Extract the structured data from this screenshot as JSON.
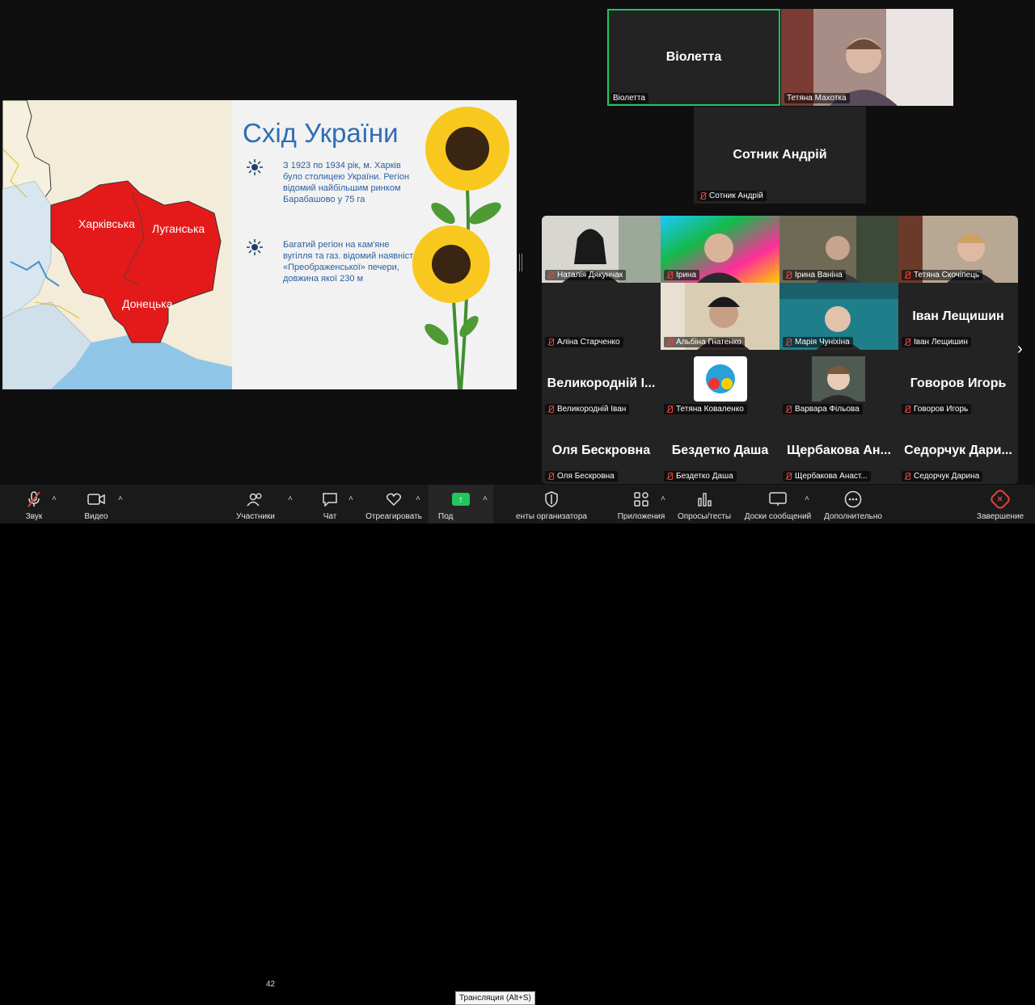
{
  "slide": {
    "title": "Схід України",
    "bullets": [
      "З 1923 по 1934 рік, м. Харків було столицею України. Регіон відомий найбільшим ринком Барабашово у 75 га",
      "Багатий регіон на кам'яне вугілля та газ. відомий наявністю «Преображенської» печери, довжина якої 230 м"
    ],
    "regions": [
      "Харківська",
      "Луганська",
      "Донецька"
    ]
  },
  "top_tiles": [
    {
      "big": "Віолетта",
      "caption": "Віолетта"
    },
    {
      "caption": "Тетяна Махотка"
    },
    {
      "big": "Сотник Андрій",
      "caption": "Сотник Андрій"
    }
  ],
  "gallery": [
    {
      "caption": "Наталія Дякунчак"
    },
    {
      "caption": "Ірина"
    },
    {
      "caption": "Ірина Ваніна"
    },
    {
      "caption": "Тетяна Скочіпець"
    },
    {
      "caption": "Аліна Старченко"
    },
    {
      "caption": "Альбіна Гнатенко"
    },
    {
      "caption": "Марія Чуніхіна"
    },
    {
      "big": "Іван Лещишин",
      "caption": "Іван Лещишин"
    },
    {
      "big": "Великородній І...",
      "caption": "Великородній Іван"
    },
    {
      "caption": "Тетяна Коваленко"
    },
    {
      "caption": "Варвара Фільова"
    },
    {
      "big": "Говоров Игорь",
      "caption": "Говоров Игорь"
    },
    {
      "big": "Оля Бескровна",
      "caption": "Оля Бескровна"
    },
    {
      "big": "Бездетко Даша",
      "caption": "Бездетко Даша"
    },
    {
      "big": "Щербакова Ан...",
      "caption": "Щербакова Анаст..."
    },
    {
      "big": "Седорчук Дари...",
      "caption": "Седорчук Дарина"
    }
  ],
  "toolbar": {
    "audio": "Звук",
    "video": "Видео",
    "participants": "Участники",
    "participants_count": "42",
    "chat": "Чат",
    "react": "Отреагировать",
    "share": "Под",
    "host_tools": "енты организатора",
    "apps": "Приложения",
    "polls": "Опросы/тесты",
    "whiteboards": "Доски сообщений",
    "more": "Дополнительно",
    "end": "Завершение",
    "share_tooltip": "Трансляция (Alt+S)"
  },
  "colors": {
    "accent_green": "#22c55e",
    "mute_red": "#e34242",
    "map_red": "#e41a1a"
  }
}
